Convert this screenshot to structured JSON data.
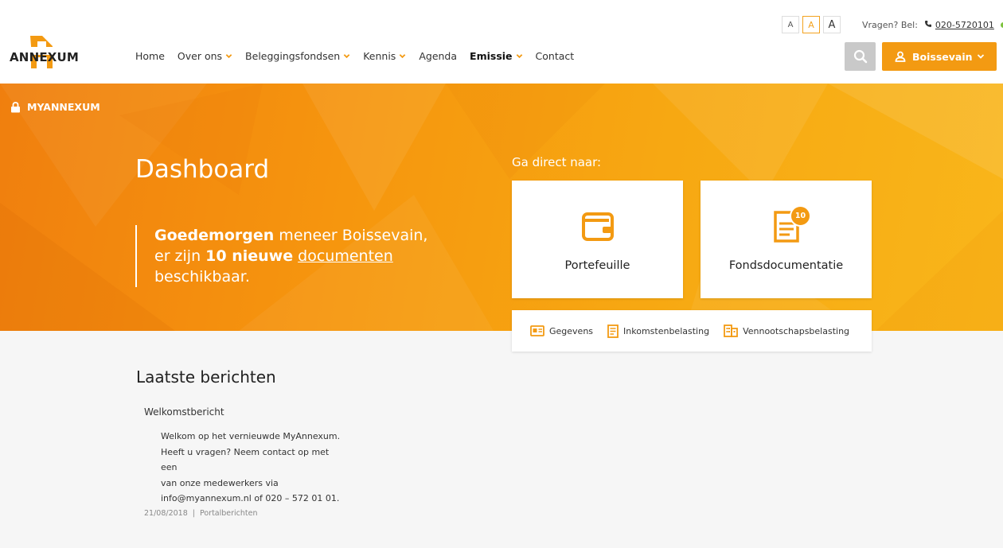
{
  "brand": {
    "logo_text": "ANNEXUM",
    "accent": "#f39a12"
  },
  "header": {
    "nav": [
      {
        "label": "Home",
        "dropdown": false,
        "bold": false
      },
      {
        "label": "Over ons",
        "dropdown": true,
        "bold": false
      },
      {
        "label": "Beleggingsfondsen",
        "dropdown": true,
        "bold": false
      },
      {
        "label": "Kennis",
        "dropdown": true,
        "bold": false
      },
      {
        "label": "Agenda",
        "dropdown": false,
        "bold": false
      },
      {
        "label": "Emissie",
        "dropdown": true,
        "bold": true
      },
      {
        "label": "Contact",
        "dropdown": false,
        "bold": false
      }
    ],
    "font_sizes": [
      "A",
      "A",
      "A"
    ],
    "contact_label": "Vragen? Bel:",
    "phone": "020-5720101",
    "account_label": "Boissevain"
  },
  "hero": {
    "section_label": "MYANNEXUM",
    "title": "Dashboard",
    "greeting_bold": "Goedemorgen",
    "greeting_rest": " meneer Boissevain,",
    "line2_pre": "er zijn ",
    "line2_bold": "10 nieuwe",
    "line2_link": "documenten",
    "line3": "beschikbaar.",
    "quick_title": "Ga direct naar:",
    "cards": [
      {
        "label": "Portefeuille",
        "icon": "wallet-icon"
      },
      {
        "label": "Fondsdocumentatie",
        "icon": "document-icon",
        "badge": "10"
      }
    ],
    "quick_links": [
      {
        "label": "Gegevens",
        "icon": "id-card-icon"
      },
      {
        "label": "Inkomstenbelasting",
        "icon": "tax-form-icon"
      },
      {
        "label": "Vennootschapsbelasting",
        "icon": "building-icon"
      }
    ]
  },
  "news": {
    "title": "Laatste berichten",
    "items": [
      {
        "title": "Welkomstbericht",
        "body": [
          "Welkom op het vernieuwde MyAnnexum.",
          "Heeft u vragen? Neem contact op met een",
          "van onze medewerkers via",
          "info@myannexum.nl of 020 – 572 01 01."
        ],
        "date": "21/08/2018",
        "category": "Portalberichten"
      }
    ]
  }
}
